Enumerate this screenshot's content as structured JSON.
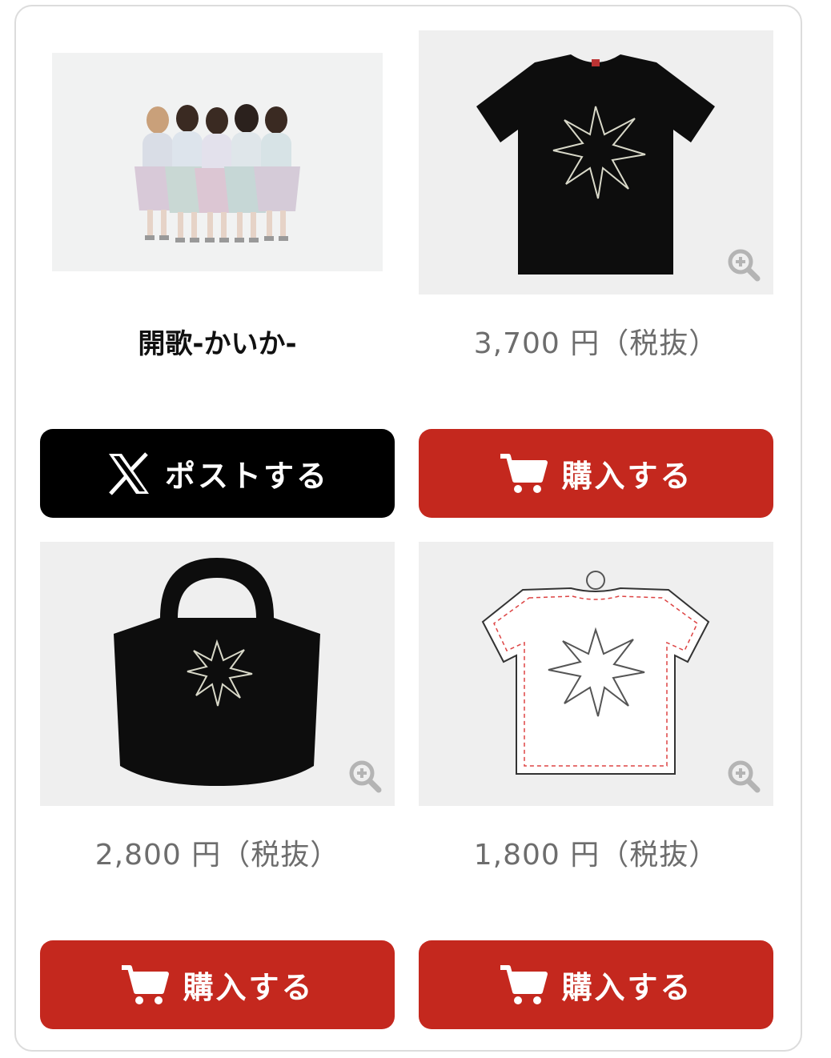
{
  "artist": {
    "name": "開歌-かいか-"
  },
  "share_button": {
    "label": "ポストする",
    "icon": "x-logo-icon"
  },
  "products": [
    {
      "name": "black-tshirt",
      "price": "3,700 円（税抜）",
      "buy_label": "購入する"
    },
    {
      "name": "black-tote-bag",
      "price": "2,800 円（税抜）",
      "buy_label": "購入する"
    },
    {
      "name": "tshirt-acrylic-keychain",
      "price": "1,800 円（税抜）",
      "buy_label": "購入する"
    }
  ],
  "colors": {
    "buy_button": "#c4281e",
    "share_button": "#000000",
    "price_text": "#6d6d6d",
    "tile_background": "#efefef"
  },
  "icons": {
    "cart": "cart-icon",
    "zoom": "zoom-in-icon"
  }
}
